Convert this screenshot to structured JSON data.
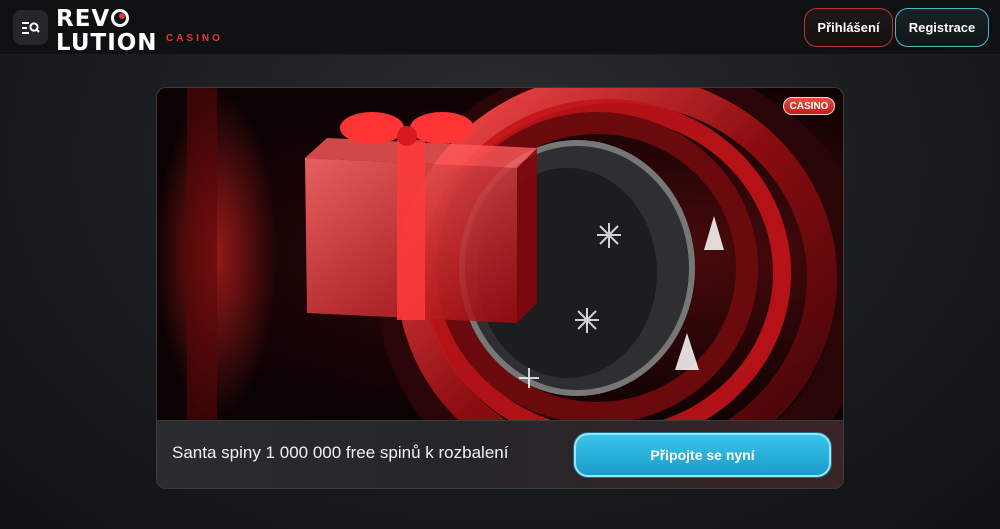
{
  "header": {
    "menu_icon": "menu-search-icon",
    "logo": {
      "main_before": "REV",
      "main_after": "LUTION",
      "sub": "CASINO"
    },
    "login_label": "Přihlášení",
    "register_label": "Registrace"
  },
  "promo": {
    "badge": "CASINO",
    "title": "Santa spiny 1 000 000 free spinů k rozbalení",
    "cta_label": "Připojte se nyní",
    "image_icons": [
      "gift-box-icon",
      "wheel-icon",
      "snowflake-icon",
      "christmas-tree-icon"
    ]
  },
  "colors": {
    "accent_red": "#e8353a",
    "cta_cyan": "#2bb3dd",
    "background": "#1a1c1f"
  }
}
